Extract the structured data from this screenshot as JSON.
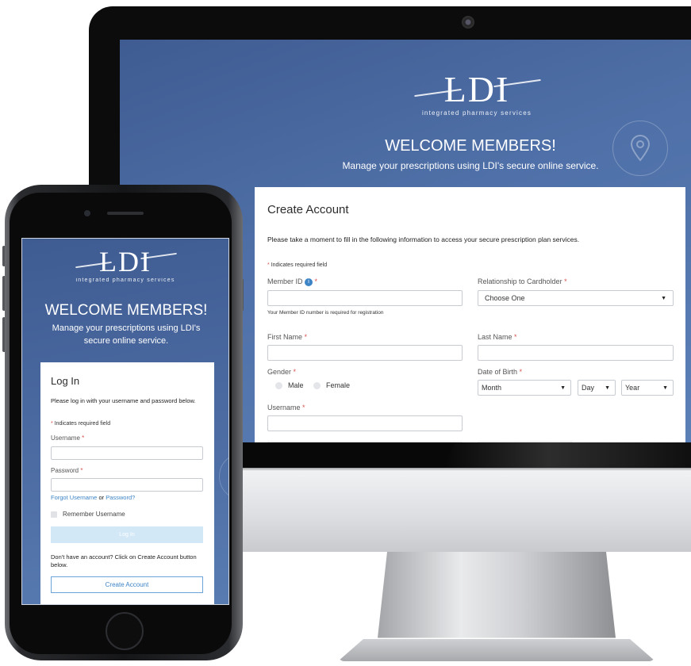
{
  "brand": {
    "logo": "LDI",
    "tagline": "integrated pharmacy services"
  },
  "desktop": {
    "welcome_title": "WELCOME MEMBERS!",
    "welcome_subtitle": "Manage your prescriptions using LDI's secure online service.",
    "create_account": {
      "heading": "Create Account",
      "intro": "Please take a moment to fill in the following information to access your secure prescription plan services.",
      "required_note": "Indicates required field",
      "member_id_label": "Member ID",
      "member_id_help": "Your Member ID number is required for registration",
      "relationship_label": "Relationship to Cardholder",
      "relationship_value": "Choose One",
      "first_name_label": "First Name",
      "last_name_label": "Last Name",
      "gender_label": "Gender",
      "gender_options": [
        "Male",
        "Female"
      ],
      "dob_label": "Date of Birth",
      "dob_month": "Month",
      "dob_day": "Day",
      "dob_year": "Year",
      "username_label": "Username"
    }
  },
  "mobile": {
    "welcome_title": "WELCOME MEMBERS!",
    "welcome_subtitle_line1": "Manage your prescriptions using LDI's",
    "welcome_subtitle_line2": "secure online service.",
    "login": {
      "heading": "Log In",
      "intro": "Please log in with your username and password below.",
      "required_note": "Indicates required field",
      "username_label": "Username",
      "password_label": "Password",
      "forgot_username": "Forgot Username",
      "or_text": "or",
      "forgot_password": "Password?",
      "remember_label": "Remember Username",
      "login_button": "Log In",
      "no_account": "Don't have an account? Click on Create Account button below.",
      "create_button": "Create Account"
    }
  },
  "colors": {
    "brand_blue": "#4a6aa2",
    "link_blue": "#3d84c6",
    "required_red": "#d9534f"
  }
}
